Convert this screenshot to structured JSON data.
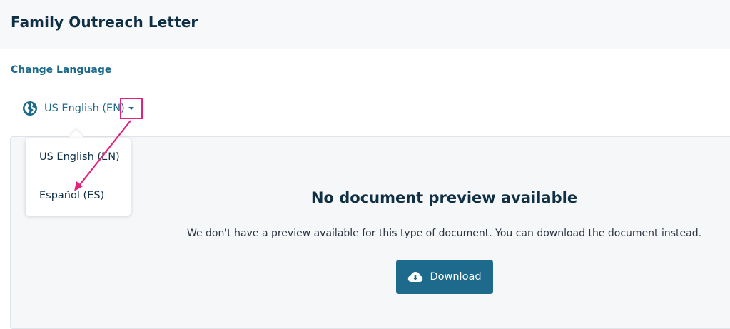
{
  "header": {
    "title": "Family Outreach Letter"
  },
  "language": {
    "section_label": "Change Language",
    "current": "US English (EN)",
    "globe_icon": "globe-icon",
    "caret_icon": "caret-down-icon",
    "options": [
      {
        "label": "US English (EN)"
      },
      {
        "label": "Español (ES)"
      }
    ]
  },
  "preview": {
    "title": "No document preview available",
    "message": "We don't have a preview available for this type of document. You can download the document instead.",
    "download_label": "Download",
    "download_icon": "cloud-download-icon"
  },
  "colors": {
    "brand": "#1d6a8d",
    "heading": "#0f2f45",
    "annotation": "#e5227a"
  }
}
